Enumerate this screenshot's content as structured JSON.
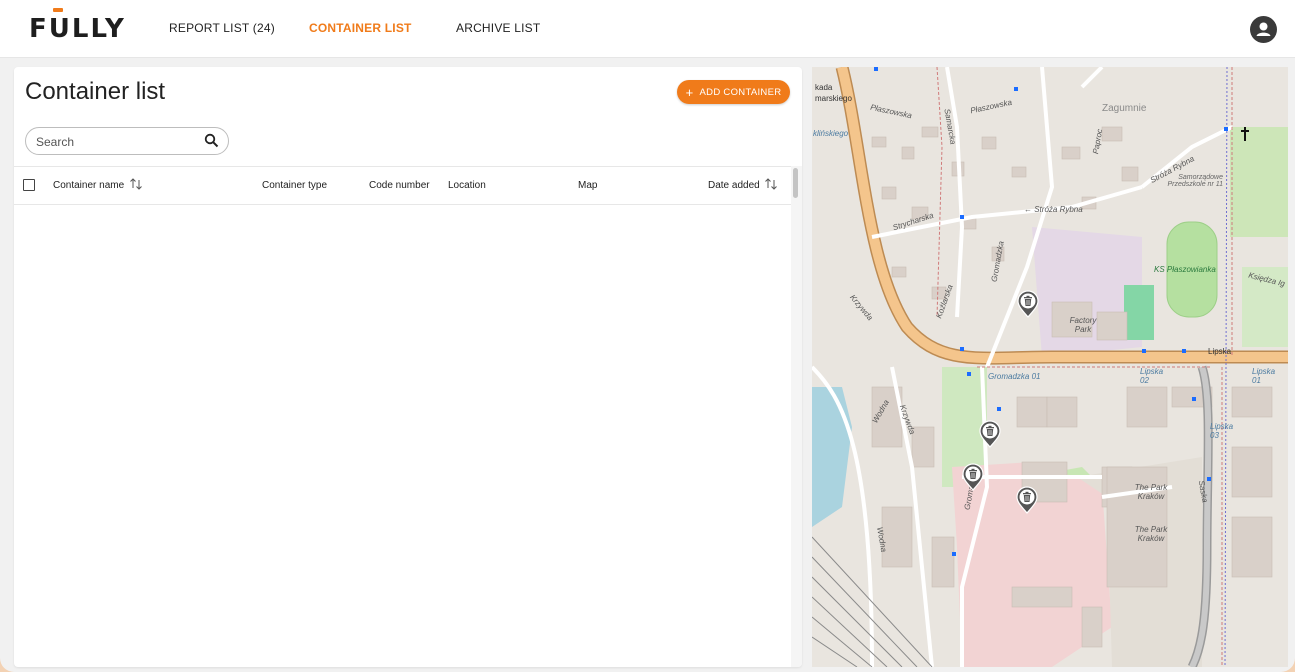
{
  "app": {
    "logo_text": "FULLY"
  },
  "nav": {
    "tabs": [
      {
        "label": "REPORT LIST (24)",
        "active": false
      },
      {
        "label": "CONTAINER LIST",
        "active": true
      },
      {
        "label": "ARCHIVE LIST",
        "active": false
      }
    ]
  },
  "page": {
    "title": "Container list",
    "add_button_label": "ADD CONTAINER",
    "add_button_icon": "plus-icon"
  },
  "search": {
    "placeholder": "Search",
    "value": ""
  },
  "table": {
    "columns": [
      {
        "label": "Container name",
        "sortable": true
      },
      {
        "label": "Container type",
        "sortable": false
      },
      {
        "label": "Code number",
        "sortable": false
      },
      {
        "label": "Location",
        "sortable": false
      },
      {
        "label": "Map",
        "sortable": false
      },
      {
        "label": "Date added",
        "sortable": true
      }
    ],
    "rows": []
  },
  "map": {
    "labels": {
      "zagumnie": "Zagumnie",
      "plaszowska": "Płaszowska",
      "stroza_rybna": "Stróża Rybna",
      "stroza_rybna_2": "← Stróża Rybna",
      "samorzadowe": "Samorządowe Przedszkole nr 11",
      "ks_plaszowianka": "KS Płaszowianka",
      "factory_park": "Factory Park",
      "gromadzka_01": "Gromadzka 01",
      "lipska": "Lipska",
      "lipska_02": "Lipska 02",
      "lipska_01": "Lipska 01",
      "lipska_03": "Lipska 03",
      "the_park_krakow_1": "The Park Kraków",
      "the_park_krakow_2": "The Park Kraków",
      "strycharska": "Strycharska",
      "krzywda": "Krzywda",
      "wodna": "Wodna",
      "kozlarska": "Koźlarska",
      "gromadzka": "Gromadzka",
      "saska": "Saska",
      "ksiedza": "Księdza Ig",
      "kada": "kada",
      "marskiego": "marskiego",
      "klinskiego": "klińskiego",
      "samarka": "Samarcka",
      "paproc": "Paproc"
    },
    "markers": 4,
    "colors": {
      "main_road": "#f4c58c",
      "park": "#c8e6b4",
      "industrial": "#f2d3d3",
      "water": "#aad3df",
      "pin": "#555555"
    }
  },
  "colors": {
    "accent": "#f07b1a",
    "header_bg": "#ffffff",
    "page_bg": "#f1f1f1"
  }
}
